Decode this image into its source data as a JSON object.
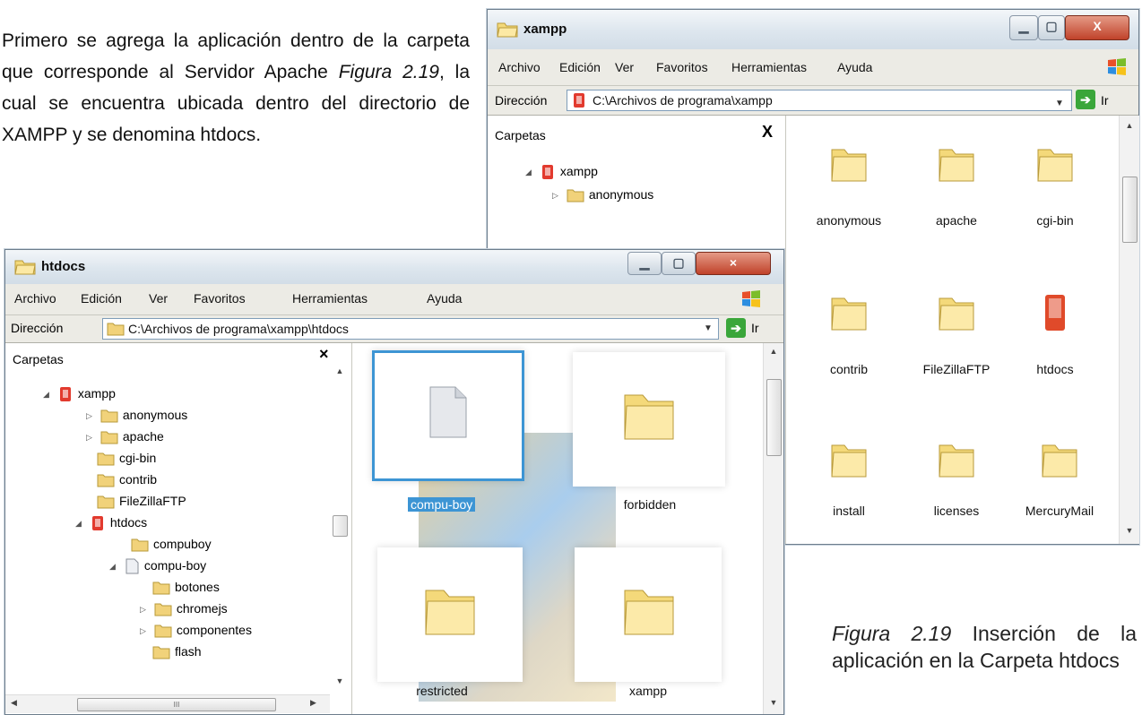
{
  "document": {
    "paragraph_before": "Primero se agrega la aplicación dentro de la carpeta que corresponde al Servidor Apache ",
    "paragraph_figure_ref": "Figura 2.19",
    "paragraph_after": ", la cual se encuentra ubicada dentro del directorio de XAMPP y se denomina htdocs.",
    "caption_ref": "Figura 2.19",
    "caption_text": " Inserción de la aplicación en la Carpeta htdocs"
  },
  "menu": [
    "Archivo",
    "Edición",
    "Ver",
    "Favoritos",
    "Herramientas",
    "Ayuda"
  ],
  "window_back": {
    "title": "xampp",
    "address_label": "Dirección",
    "address": "C:\\Archivos de programa\\xampp",
    "go_label": "Ir",
    "pane_title": "Carpetas",
    "pane_close": "X",
    "tree": [
      {
        "label": "xampp",
        "type": "red"
      },
      {
        "label": "anonymous",
        "type": "folder"
      }
    ],
    "items": [
      "anonymous",
      "apache",
      "cgi-bin",
      "contrib",
      "FileZillaFTP",
      "htdocs",
      "install",
      "licenses",
      "MercuryMail"
    ]
  },
  "window_front": {
    "title": "htdocs",
    "address_label": "Dirección",
    "address": "C:\\Archivos de programa\\xampp\\htdocs",
    "go_label": "Ir",
    "pane_title": "Carpetas",
    "pane_close": "×",
    "tree": [
      {
        "label": "xampp",
        "type": "red"
      },
      {
        "label": "anonymous",
        "type": "folder"
      },
      {
        "label": "apache",
        "type": "folder"
      },
      {
        "label": "cgi-bin",
        "type": "folder"
      },
      {
        "label": "contrib",
        "type": "folder"
      },
      {
        "label": "FileZillaFTP",
        "type": "folder"
      },
      {
        "label": "htdocs",
        "type": "red"
      },
      {
        "label": "compuboy",
        "type": "folder"
      },
      {
        "label": "compu-boy",
        "type": "doc"
      },
      {
        "label": "botones",
        "type": "folder"
      },
      {
        "label": "chromejs",
        "type": "folder"
      },
      {
        "label": "componentes",
        "type": "folder"
      },
      {
        "label": "flash",
        "type": "folder"
      }
    ],
    "items": [
      "compu-boy",
      "forbidden",
      "restricted",
      "xampp"
    ],
    "hscroll_grip": "III"
  }
}
